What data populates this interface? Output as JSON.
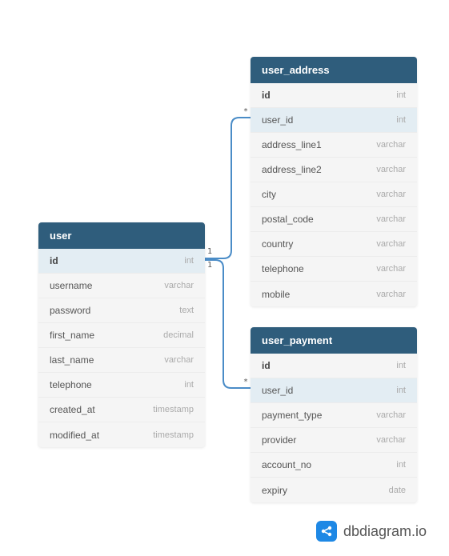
{
  "tables": {
    "user": {
      "name": "user",
      "fields": [
        {
          "name": "id",
          "type": "int",
          "pk": true
        },
        {
          "name": "username",
          "type": "varchar"
        },
        {
          "name": "password",
          "type": "text"
        },
        {
          "name": "first_name",
          "type": "decimal"
        },
        {
          "name": "last_name",
          "type": "varchar"
        },
        {
          "name": "telephone",
          "type": "int"
        },
        {
          "name": "created_at",
          "type": "timestamp"
        },
        {
          "name": "modified_at",
          "type": "timestamp"
        }
      ]
    },
    "user_address": {
      "name": "user_address",
      "fields": [
        {
          "name": "id",
          "type": "int",
          "pk": true
        },
        {
          "name": "user_id",
          "type": "int",
          "fk": true
        },
        {
          "name": "address_line1",
          "type": "varchar"
        },
        {
          "name": "address_line2",
          "type": "varchar"
        },
        {
          "name": "city",
          "type": "varchar"
        },
        {
          "name": "postal_code",
          "type": "varchar"
        },
        {
          "name": "country",
          "type": "varchar"
        },
        {
          "name": "telephone",
          "type": "varchar"
        },
        {
          "name": "mobile",
          "type": "varchar"
        }
      ]
    },
    "user_payment": {
      "name": "user_payment",
      "fields": [
        {
          "name": "id",
          "type": "int",
          "pk": true
        },
        {
          "name": "user_id",
          "type": "int",
          "fk": true
        },
        {
          "name": "payment_type",
          "type": "varchar"
        },
        {
          "name": "provider",
          "type": "varchar"
        },
        {
          "name": "account_no",
          "type": "int"
        },
        {
          "name": "expiry",
          "type": "date"
        }
      ]
    }
  },
  "relationships": [
    {
      "from": "user.id",
      "to": "user_address.user_id",
      "from_card": "1",
      "to_card": "*"
    },
    {
      "from": "user.id",
      "to": "user_payment.user_id",
      "from_card": "1",
      "to_card": "*"
    }
  ],
  "watermark": {
    "text": "dbdiagram.io"
  },
  "cardinality": {
    "one_top": "1",
    "one_bottom": "1",
    "many_top": "*",
    "many_bottom": "*"
  }
}
